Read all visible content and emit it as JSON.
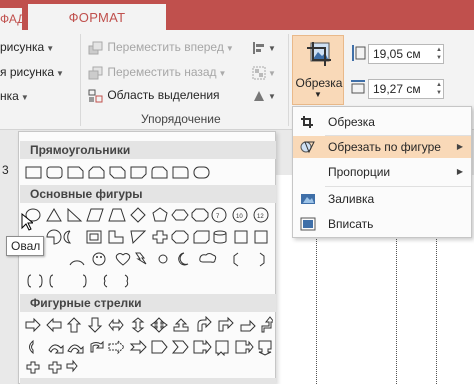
{
  "tabs": {
    "left_partial": "ФАД",
    "active": "ФОРМАТ"
  },
  "ribbon": {
    "left_items": [
      "рисунка",
      "я рисунка",
      "нка"
    ],
    "arrange": {
      "bring_forward": "Переместить вперед",
      "send_backward": "Переместить назад",
      "selection_pane": "Область выделения",
      "group_label": "Упорядочение"
    },
    "crop_button": "Обрезка",
    "height_value": "19,05 см",
    "width_value": "19,27 см"
  },
  "crop_menu": {
    "items": [
      {
        "label": "Обрезка",
        "icon": "crop-icon",
        "submenu": false
      },
      {
        "label": "Обрезать по фигуре",
        "icon": "crop-to-shape-icon",
        "submenu": true,
        "highlighted": true
      },
      {
        "label": "Пропорции",
        "icon": "",
        "submenu": true
      },
      {
        "label": "Заливка",
        "icon": "fill-icon",
        "submenu": false
      },
      {
        "label": "Вписать",
        "icon": "fit-icon",
        "submenu": false
      }
    ]
  },
  "gallery": {
    "section_rectangles": "Прямоугольники",
    "section_basic": "Основные фигуры",
    "section_arrows": "Фигурные стрелки",
    "tooltip": "Овал"
  },
  "left_number": "3",
  "colors": {
    "accent": "#c0504d",
    "highlight": "#f9d9b8"
  }
}
